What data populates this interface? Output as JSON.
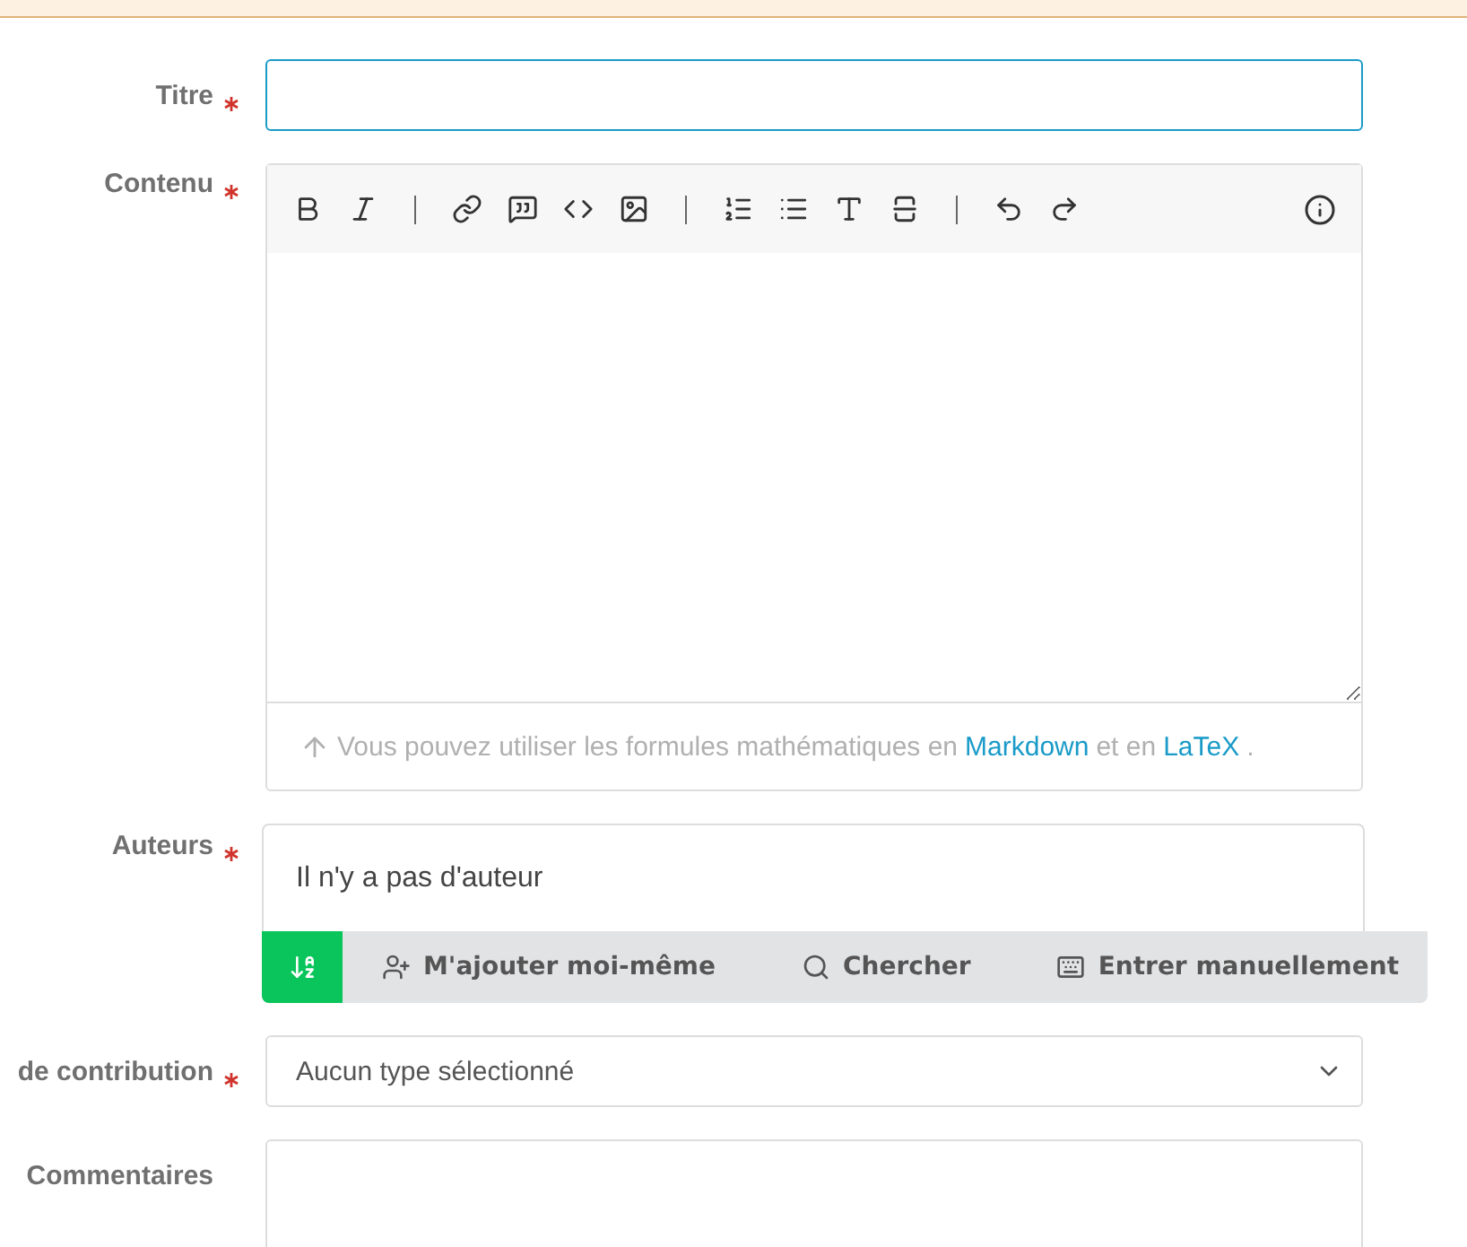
{
  "form": [
    {
      "kind": "text",
      "label": "Titre",
      "required": true,
      "focused": true
    },
    {
      "kind": "editor",
      "label": "Contenu",
      "required": true,
      "hint": {
        "before": "Vous pouvez utiliser les formules mathématiques en",
        "link1": "Markdown",
        "middle": "et en",
        "link2": "LaTeX",
        "after": "."
      }
    },
    {
      "kind": "authors",
      "label": "Auteurs",
      "required": true,
      "value": "Il n'y a pas d'auteur",
      "actions": [
        "M'ajouter moi-même",
        "Chercher",
        "Entrer manuellement"
      ]
    },
    {
      "kind": "select",
      "label": "de contribution",
      "required": true,
      "value": "Aucun type sélectionné"
    },
    {
      "kind": "textarea",
      "label": "Commentaires",
      "required": false
    }
  ]
}
